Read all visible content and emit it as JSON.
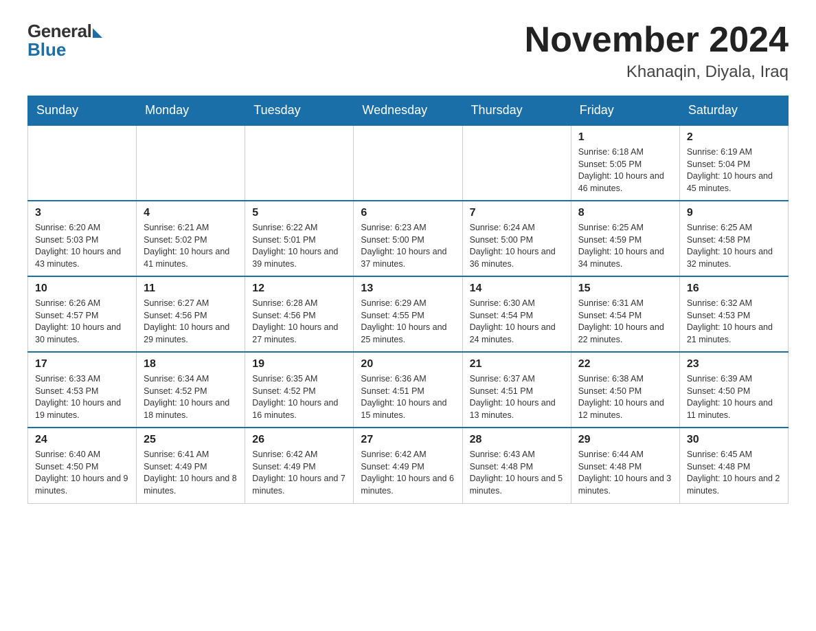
{
  "logo": {
    "general": "General",
    "blue": "Blue"
  },
  "header": {
    "month_year": "November 2024",
    "location": "Khanaqin, Diyala, Iraq"
  },
  "weekdays": [
    "Sunday",
    "Monday",
    "Tuesday",
    "Wednesday",
    "Thursday",
    "Friday",
    "Saturday"
  ],
  "weeks": [
    {
      "days": [
        {
          "num": "",
          "info": ""
        },
        {
          "num": "",
          "info": ""
        },
        {
          "num": "",
          "info": ""
        },
        {
          "num": "",
          "info": ""
        },
        {
          "num": "",
          "info": ""
        },
        {
          "num": "1",
          "info": "Sunrise: 6:18 AM\nSunset: 5:05 PM\nDaylight: 10 hours and 46 minutes."
        },
        {
          "num": "2",
          "info": "Sunrise: 6:19 AM\nSunset: 5:04 PM\nDaylight: 10 hours and 45 minutes."
        }
      ]
    },
    {
      "days": [
        {
          "num": "3",
          "info": "Sunrise: 6:20 AM\nSunset: 5:03 PM\nDaylight: 10 hours and 43 minutes."
        },
        {
          "num": "4",
          "info": "Sunrise: 6:21 AM\nSunset: 5:02 PM\nDaylight: 10 hours and 41 minutes."
        },
        {
          "num": "5",
          "info": "Sunrise: 6:22 AM\nSunset: 5:01 PM\nDaylight: 10 hours and 39 minutes."
        },
        {
          "num": "6",
          "info": "Sunrise: 6:23 AM\nSunset: 5:00 PM\nDaylight: 10 hours and 37 minutes."
        },
        {
          "num": "7",
          "info": "Sunrise: 6:24 AM\nSunset: 5:00 PM\nDaylight: 10 hours and 36 minutes."
        },
        {
          "num": "8",
          "info": "Sunrise: 6:25 AM\nSunset: 4:59 PM\nDaylight: 10 hours and 34 minutes."
        },
        {
          "num": "9",
          "info": "Sunrise: 6:25 AM\nSunset: 4:58 PM\nDaylight: 10 hours and 32 minutes."
        }
      ]
    },
    {
      "days": [
        {
          "num": "10",
          "info": "Sunrise: 6:26 AM\nSunset: 4:57 PM\nDaylight: 10 hours and 30 minutes."
        },
        {
          "num": "11",
          "info": "Sunrise: 6:27 AM\nSunset: 4:56 PM\nDaylight: 10 hours and 29 minutes."
        },
        {
          "num": "12",
          "info": "Sunrise: 6:28 AM\nSunset: 4:56 PM\nDaylight: 10 hours and 27 minutes."
        },
        {
          "num": "13",
          "info": "Sunrise: 6:29 AM\nSunset: 4:55 PM\nDaylight: 10 hours and 25 minutes."
        },
        {
          "num": "14",
          "info": "Sunrise: 6:30 AM\nSunset: 4:54 PM\nDaylight: 10 hours and 24 minutes."
        },
        {
          "num": "15",
          "info": "Sunrise: 6:31 AM\nSunset: 4:54 PM\nDaylight: 10 hours and 22 minutes."
        },
        {
          "num": "16",
          "info": "Sunrise: 6:32 AM\nSunset: 4:53 PM\nDaylight: 10 hours and 21 minutes."
        }
      ]
    },
    {
      "days": [
        {
          "num": "17",
          "info": "Sunrise: 6:33 AM\nSunset: 4:53 PM\nDaylight: 10 hours and 19 minutes."
        },
        {
          "num": "18",
          "info": "Sunrise: 6:34 AM\nSunset: 4:52 PM\nDaylight: 10 hours and 18 minutes."
        },
        {
          "num": "19",
          "info": "Sunrise: 6:35 AM\nSunset: 4:52 PM\nDaylight: 10 hours and 16 minutes."
        },
        {
          "num": "20",
          "info": "Sunrise: 6:36 AM\nSunset: 4:51 PM\nDaylight: 10 hours and 15 minutes."
        },
        {
          "num": "21",
          "info": "Sunrise: 6:37 AM\nSunset: 4:51 PM\nDaylight: 10 hours and 13 minutes."
        },
        {
          "num": "22",
          "info": "Sunrise: 6:38 AM\nSunset: 4:50 PM\nDaylight: 10 hours and 12 minutes."
        },
        {
          "num": "23",
          "info": "Sunrise: 6:39 AM\nSunset: 4:50 PM\nDaylight: 10 hours and 11 minutes."
        }
      ]
    },
    {
      "days": [
        {
          "num": "24",
          "info": "Sunrise: 6:40 AM\nSunset: 4:50 PM\nDaylight: 10 hours and 9 minutes."
        },
        {
          "num": "25",
          "info": "Sunrise: 6:41 AM\nSunset: 4:49 PM\nDaylight: 10 hours and 8 minutes."
        },
        {
          "num": "26",
          "info": "Sunrise: 6:42 AM\nSunset: 4:49 PM\nDaylight: 10 hours and 7 minutes."
        },
        {
          "num": "27",
          "info": "Sunrise: 6:42 AM\nSunset: 4:49 PM\nDaylight: 10 hours and 6 minutes."
        },
        {
          "num": "28",
          "info": "Sunrise: 6:43 AM\nSunset: 4:48 PM\nDaylight: 10 hours and 5 minutes."
        },
        {
          "num": "29",
          "info": "Sunrise: 6:44 AM\nSunset: 4:48 PM\nDaylight: 10 hours and 3 minutes."
        },
        {
          "num": "30",
          "info": "Sunrise: 6:45 AM\nSunset: 4:48 PM\nDaylight: 10 hours and 2 minutes."
        }
      ]
    }
  ]
}
